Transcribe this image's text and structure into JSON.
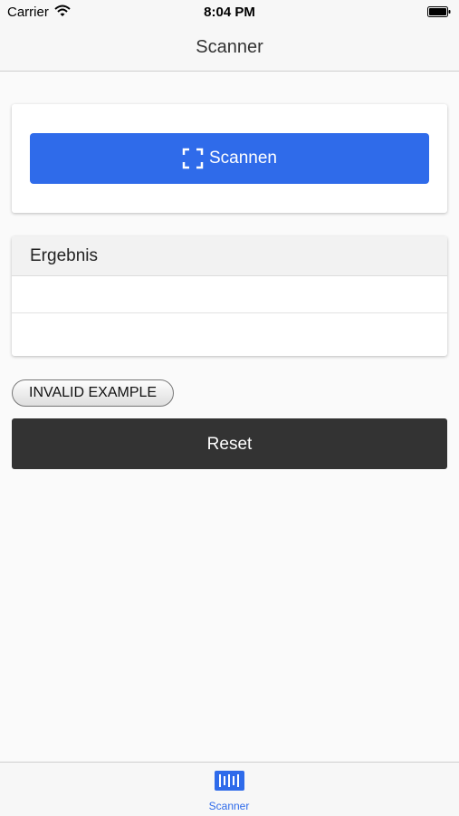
{
  "status_bar": {
    "carrier": "Carrier",
    "time": "8:04 PM",
    "icons": [
      "wifi-icon",
      "battery-icon"
    ]
  },
  "nav": {
    "title": "Scanner"
  },
  "scan_card": {
    "button_label": "Scannen",
    "button_icon": "scan-frame-icon"
  },
  "result_card": {
    "header": "Ergebnis",
    "rows": [
      "",
      ""
    ]
  },
  "invalid_button": {
    "label": "INVALID EXAMPLE"
  },
  "reset_button": {
    "label": "Reset"
  },
  "tab_bar": {
    "items": [
      {
        "label": "Scanner",
        "icon": "barcode-icon",
        "active": true
      }
    ]
  },
  "colors": {
    "accent": "#2f6bea",
    "dark_button": "#333333",
    "bar_background": "#f7f7f7"
  }
}
